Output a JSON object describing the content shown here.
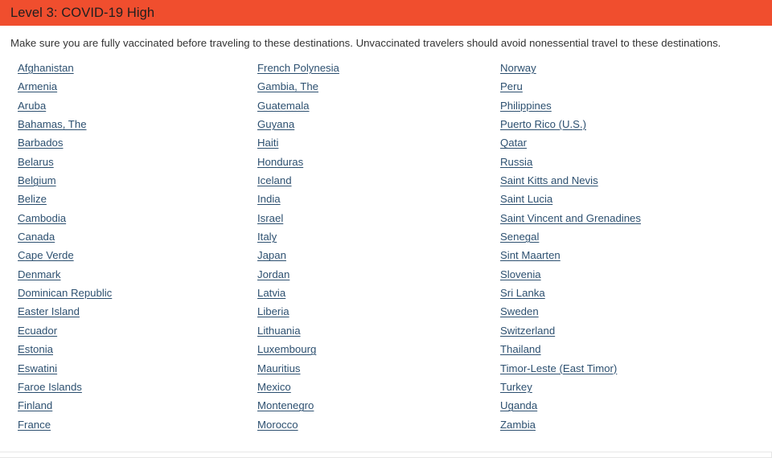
{
  "colors": {
    "banner_background": "#f04e2e",
    "banner_text": "#1f1f1f",
    "link": "#2d5070",
    "body_text": "#333333",
    "page_background": "#ffffff",
    "rule": "#e8e8e8"
  },
  "header": {
    "title": "Level 3: COVID-19 High"
  },
  "advisory": {
    "text": "Make sure you are fully vaccinated before traveling to these destinations. Unvaccinated travelers should avoid nonessential travel to these destinations."
  },
  "destinations": {
    "columns": [
      {
        "name": "column-1",
        "items": [
          "Afghanistan",
          "Armenia",
          "Aruba",
          "Bahamas, The",
          "Barbados",
          "Belarus",
          "Belgium",
          "Belize",
          "Cambodia",
          "Canada",
          "Cape Verde",
          "Denmark",
          "Dominican Republic",
          "Easter Island",
          "Ecuador",
          "Estonia",
          "Eswatini",
          "Faroe Islands",
          "Finland",
          "France"
        ]
      },
      {
        "name": "column-2",
        "items": [
          "French Polynesia",
          "Gambia, The",
          "Guatemala",
          "Guyana",
          "Haiti",
          "Honduras",
          "Iceland",
          "India",
          "Israel",
          "Italy",
          "Japan",
          "Jordan",
          "Latvia",
          "Liberia",
          "Lithuania",
          "Luxembourg",
          "Mauritius",
          "Mexico",
          "Montenegro",
          "Morocco"
        ]
      },
      {
        "name": "column-3",
        "items": [
          "Norway",
          "Peru",
          "Philippines",
          "Puerto Rico (U.S.)",
          "Qatar",
          "Russia",
          "Saint Kitts and Nevis",
          "Saint Lucia",
          "Saint Vincent and Grenadines",
          "Senegal",
          "Sint Maarten",
          "Slovenia",
          "Sri Lanka",
          "Sweden",
          "Switzerland",
          "Thailand",
          "Timor-Leste (East Timor)",
          "Turkey",
          "Uganda",
          "Zambia"
        ]
      }
    ]
  }
}
